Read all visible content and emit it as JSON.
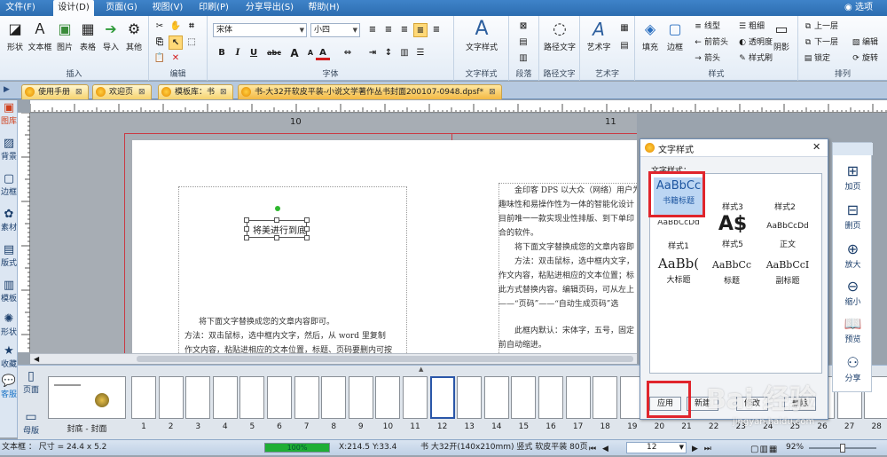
{
  "menubar": {
    "items": [
      "文件(F)",
      "设计(D)",
      "页面(G)",
      "视图(V)",
      "印刷(P)",
      "分享导出(S)",
      "帮助(H)"
    ],
    "active": "设计(D)",
    "options": "选项"
  },
  "ribbon": {
    "insert": {
      "label": "插入",
      "buttons": [
        "形状",
        "文本框",
        "图片",
        "表格",
        "导入",
        "其他"
      ]
    },
    "edit": {
      "label": "编辑"
    },
    "font": {
      "label": "字体",
      "font_name": "宋体",
      "font_size": "小四",
      "bold": "B",
      "italic": "I",
      "underline": "U",
      "strike": "abc",
      "grow": "A",
      "shrink": "A",
      "color": "A"
    },
    "text_style": {
      "label": "文字样式",
      "button": "文字样式"
    },
    "paragraph": {
      "label": "段落"
    },
    "path_text": {
      "label": "路径文字",
      "button": "路径文字"
    },
    "art_text": {
      "label": "艺术字",
      "button": "艺术字"
    },
    "style": {
      "label": "样式",
      "fill": "填充",
      "border": "边框",
      "line_shape": "线型",
      "bold_line": "粗细",
      "shadow_line": "前箭头",
      "transparency": "透明度",
      "arrow": "箭头",
      "style_brush": "样式刷",
      "shadow": "阴影"
    },
    "arrange": {
      "label": "排列",
      "up": "上一层",
      "down": "下一层",
      "edit": "编辑",
      "rotate": "旋转",
      "lock": "锁定"
    }
  },
  "tabs": [
    {
      "label": "使用手册",
      "close": "⊠"
    },
    {
      "label": "欢迎页",
      "close": "⊠"
    },
    {
      "label": "模板库：书",
      "close": "⊠"
    },
    {
      "label": "书-大32开软皮平装-小说文学著作丛书封面200107-0948.dpsf*",
      "close": "⊠"
    }
  ],
  "left_panel": [
    "图库",
    "背景",
    "边框",
    "素材",
    "版式",
    "模板",
    "形状",
    "收藏",
    "客服"
  ],
  "ruler": {
    "page_left": "10",
    "page_right": "11"
  },
  "page": {
    "textbox_label": "将美进行到底",
    "left_text": [
      "将下面文字替换成您的文章内容即可。",
      "方法：双击鼠标，选中框内文字，然后，从 word 里复制",
      "作文内容，粘贴进相应的文本位置，标题、页码要删内可按"
    ],
    "right_text": [
      "金印客 DPS 以大众（网络）用户为",
      "趣味性和易操作性为一体的智能化设计",
      "目前唯一一款实现业性排版、到下单印",
      "合的软件。",
      "将下面文字替换成您的文章内容即",
      "方法：双击鼠标，选中框内文字，",
      "作文内容，粘贴进相应的文本位置；标",
      "此方式替换内容。编辑页码，可从左上",
      "——“页码”——“自动生成页码”选",
      "此框内默认：宋体字，五号，固定",
      "前自动缩进。"
    ]
  },
  "dialog": {
    "title": "文字样式",
    "close": "✕",
    "section": "文字样式：",
    "styles": [
      {
        "sample": "AaBbCc",
        "label": "书籍标题"
      },
      {
        "sample": "",
        "label": "样式3"
      },
      {
        "sample": "",
        "label": "样式2"
      },
      {
        "sample": "AaBbCcDd",
        "label": "样式1"
      },
      {
        "sample": "A$",
        "label": "样式5"
      },
      {
        "sample": "AaBbCcDd",
        "label": "正文"
      },
      {
        "sample": "AaBb(",
        "label": "大标题"
      },
      {
        "sample": "AaBbCc",
        "label": "标题"
      },
      {
        "sample": "AaBbCcI",
        "label": "副标题"
      }
    ],
    "buttons": [
      "应用",
      "新建",
      "修改",
      "删除"
    ]
  },
  "right_panel": [
    "加页",
    "删页",
    "放大",
    "缩小",
    "预览",
    "分享"
  ],
  "thumbnails": {
    "page_tab": "页面",
    "master_tab": "母版",
    "first_label": "封底 - 封面",
    "numbers": [
      "1",
      "2",
      "3",
      "4",
      "5",
      "6",
      "7",
      "8",
      "9",
      "10",
      "11",
      "12",
      "13",
      "14",
      "15",
      "16",
      "17",
      "18",
      "19",
      "20",
      "21",
      "22",
      "23",
      "24",
      "25",
      "26",
      "27",
      "28"
    ],
    "selected": "12"
  },
  "status": {
    "object": "文本框 ： 尺寸 = 24.4 x 5.2",
    "progress_text": "100%",
    "progress": 1.0,
    "x": "X:214.5",
    "y": "Y:33.4",
    "book": "书 大32开(140x210mm) 竖式 软皮平装 80页",
    "page_num": "12",
    "zoom": "92%"
  },
  "watermark": "Bai 经验",
  "watermark_url": "jingyan.baidu.com"
}
